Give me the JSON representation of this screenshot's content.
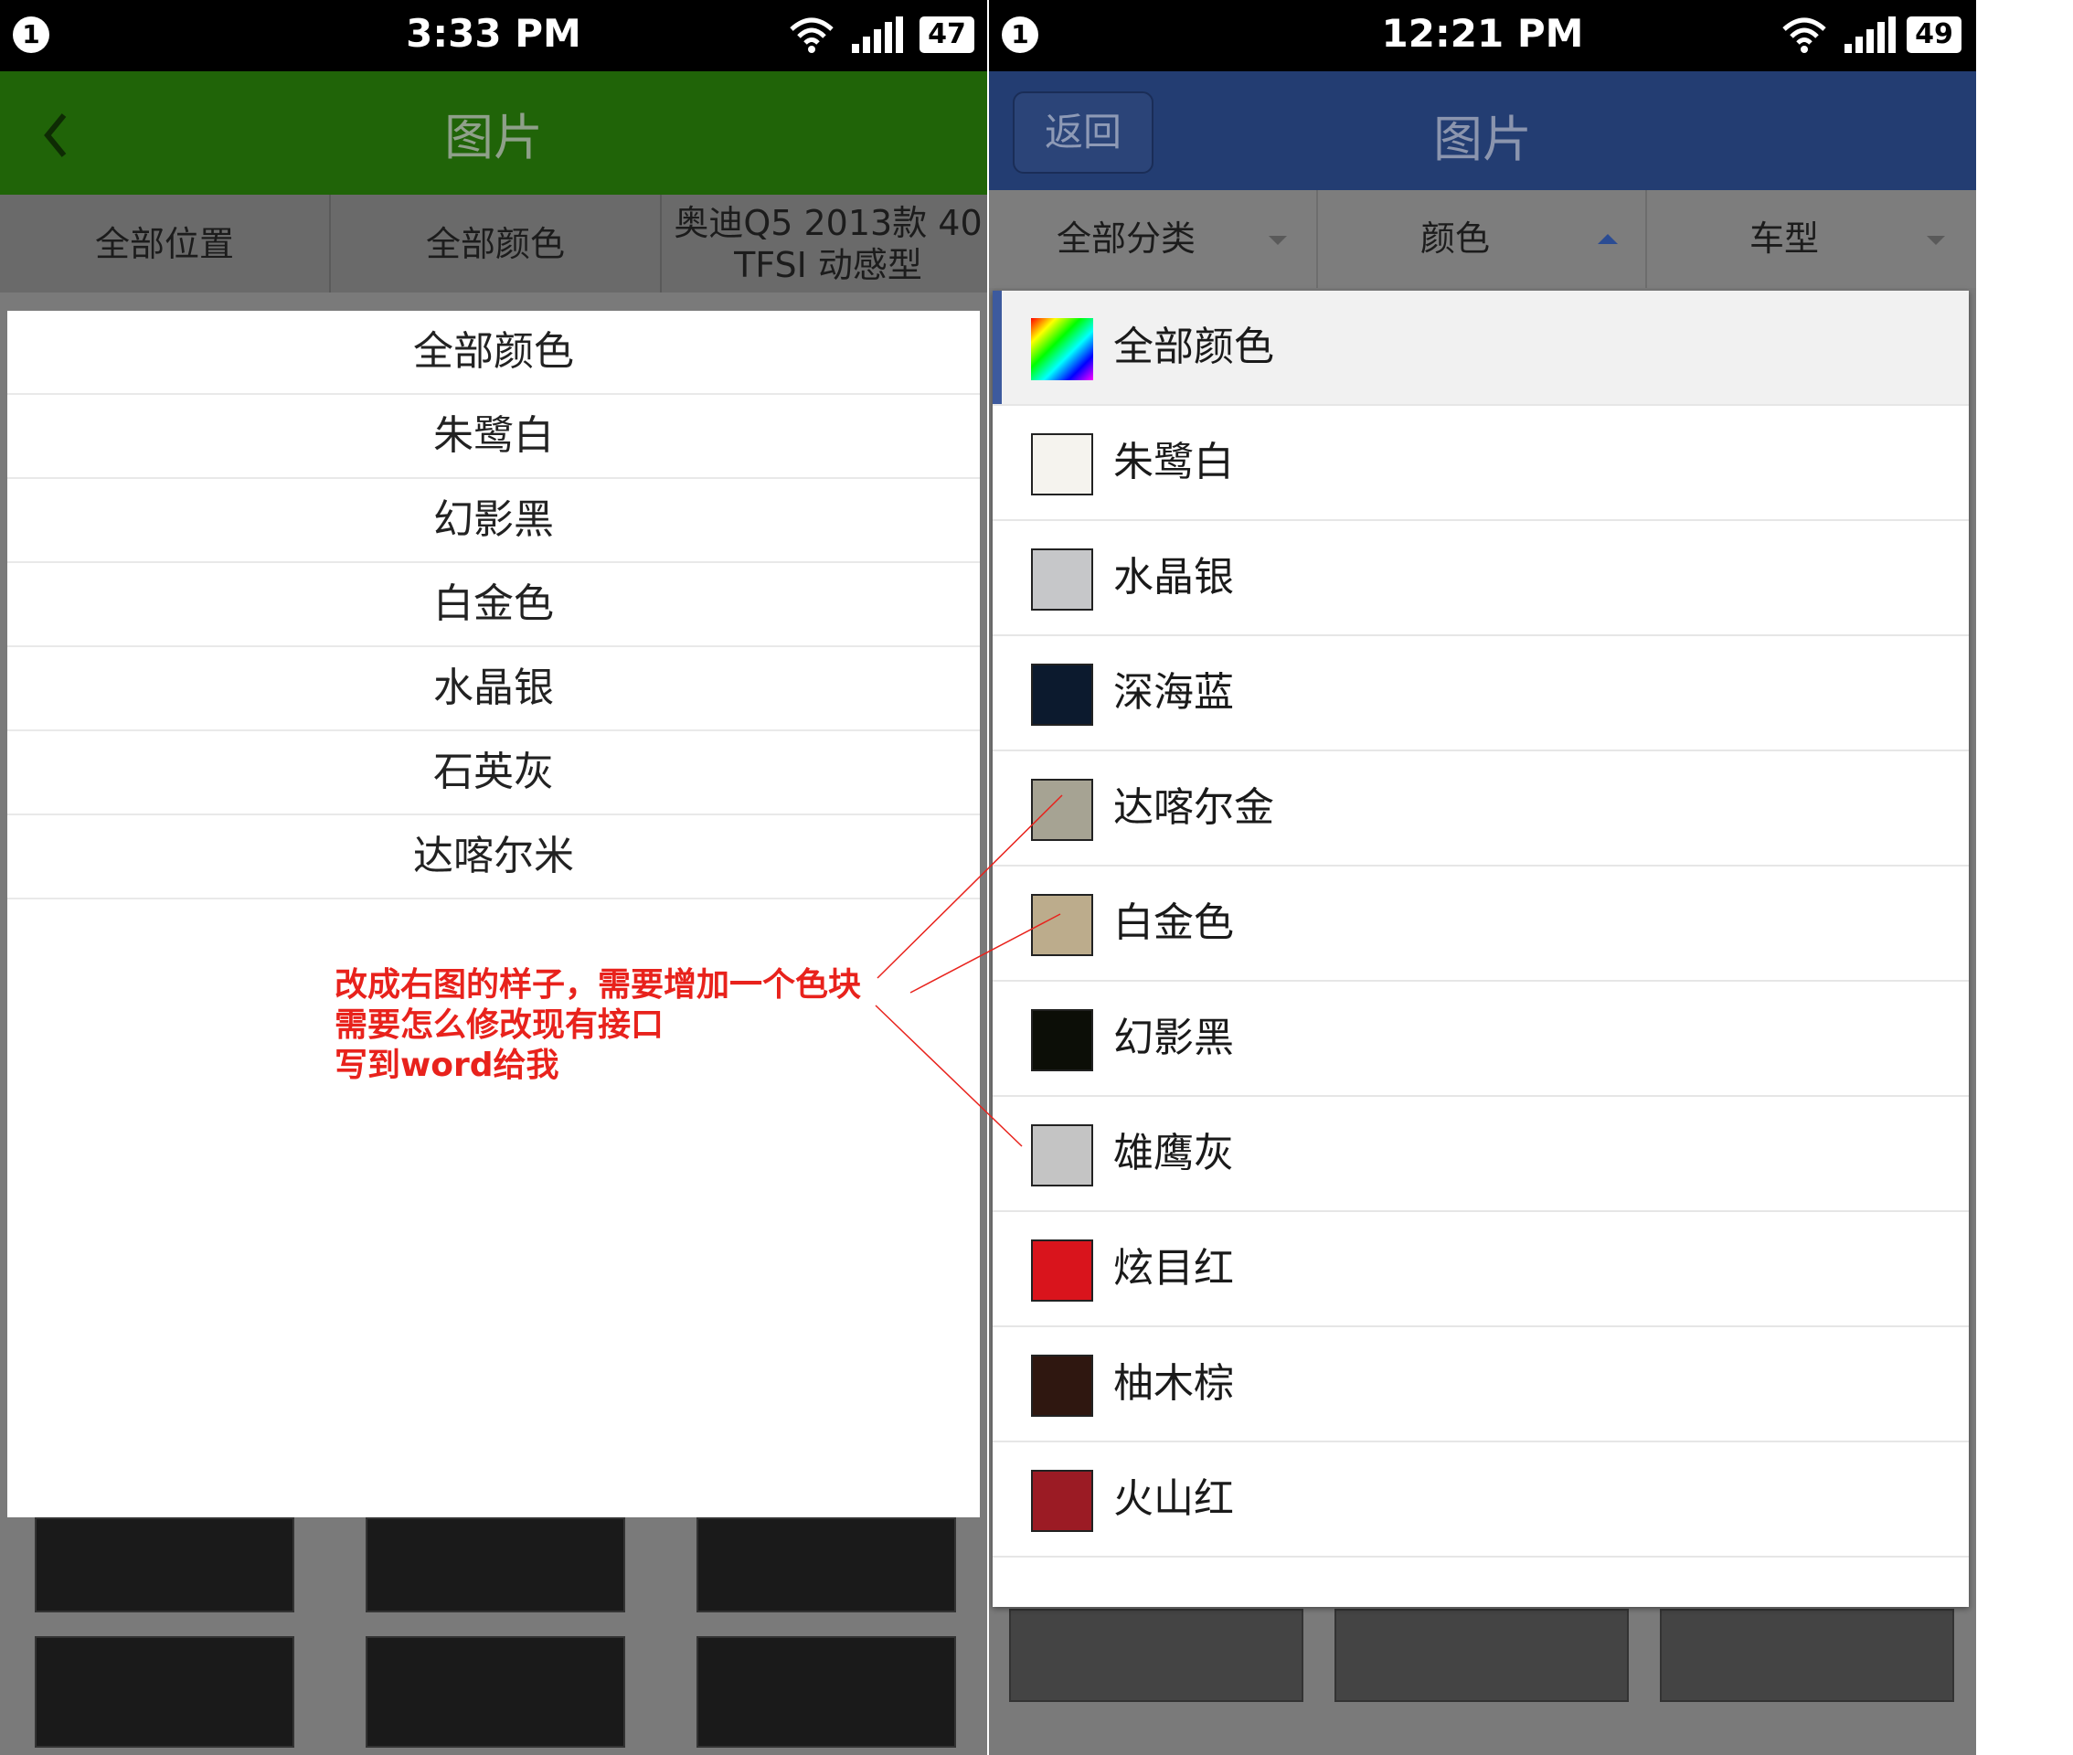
{
  "left_phone": {
    "status": {
      "notification": "1",
      "time": "3:33 PM",
      "battery": "47"
    },
    "app_bar": {
      "title": "图片"
    },
    "filters": [
      "全部位置",
      "全部颜色",
      "奥迪Q5 2013款 40 TFSI 动感型"
    ],
    "colors": [
      "全部颜色",
      "朱鹭白",
      "幻影黑",
      "白金色",
      "水晶银",
      "石英灰",
      "达喀尔米"
    ]
  },
  "right_phone": {
    "status": {
      "notification": "1",
      "time": "12:21 PM",
      "battery": "49"
    },
    "app_bar": {
      "back_label": "返回",
      "title": "图片"
    },
    "filters": [
      "全部分类",
      "颜色",
      "车型"
    ],
    "colors": [
      {
        "name": "全部颜色",
        "swatch": "rainbow",
        "selected": true
      },
      {
        "name": "朱鹭白",
        "swatch": "#f5f3ee"
      },
      {
        "name": "水晶银",
        "swatch": "#c6c7c9"
      },
      {
        "name": "深海蓝",
        "swatch": "#0c1a2e"
      },
      {
        "name": "达喀尔金",
        "swatch": "#a6a393"
      },
      {
        "name": "白金色",
        "swatch": "#bcac8c"
      },
      {
        "name": "幻影黑",
        "swatch": "#0c0e07"
      },
      {
        "name": "雄鹰灰",
        "swatch": "#c4c4c4"
      },
      {
        "name": "炫目红",
        "swatch": "#d9141c"
      },
      {
        "name": "柚木棕",
        "swatch": "#2f1710"
      },
      {
        "name": "火山红",
        "swatch": "#9b1b24"
      }
    ]
  },
  "annotation": {
    "lines": [
      "改成右图的样子，需要增加一个色块",
      "需要怎么修改现有接口",
      "写到word给我"
    ],
    "color": "#e8221c"
  }
}
